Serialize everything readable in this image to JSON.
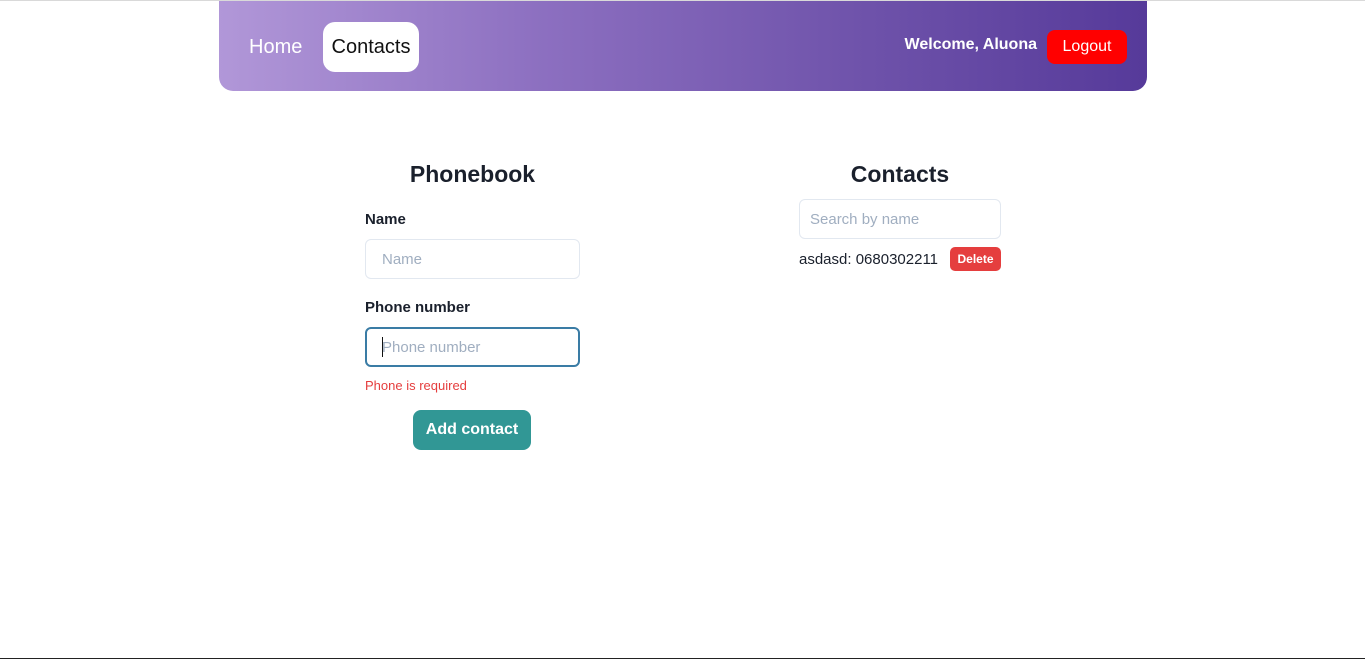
{
  "nav": {
    "home_label": "Home",
    "contacts_label": "Contacts",
    "welcome_text": "Welcome, Aluona",
    "logout_label": "Logout"
  },
  "form": {
    "title": "Phonebook",
    "name_label": "Name",
    "name_placeholder": "Name",
    "name_value": "",
    "phone_label": "Phone number",
    "phone_placeholder": "Phone number",
    "phone_value": "",
    "phone_error": "Phone is required",
    "submit_label": "Add contact"
  },
  "contacts": {
    "title": "Contacts",
    "search_placeholder": "Search by name",
    "search_value": "",
    "items": [
      {
        "text": "asdasd: 0680302211",
        "delete_label": "Delete"
      }
    ]
  },
  "colors": {
    "header_gradient_start": "#b197d8",
    "header_gradient_end": "#563a9a",
    "logout_bg": "#ff0000",
    "add_button_bg": "#319795",
    "delete_bg": "#e53e3e",
    "error_text": "#e53e3e",
    "focus_border": "#3a7ca5"
  }
}
